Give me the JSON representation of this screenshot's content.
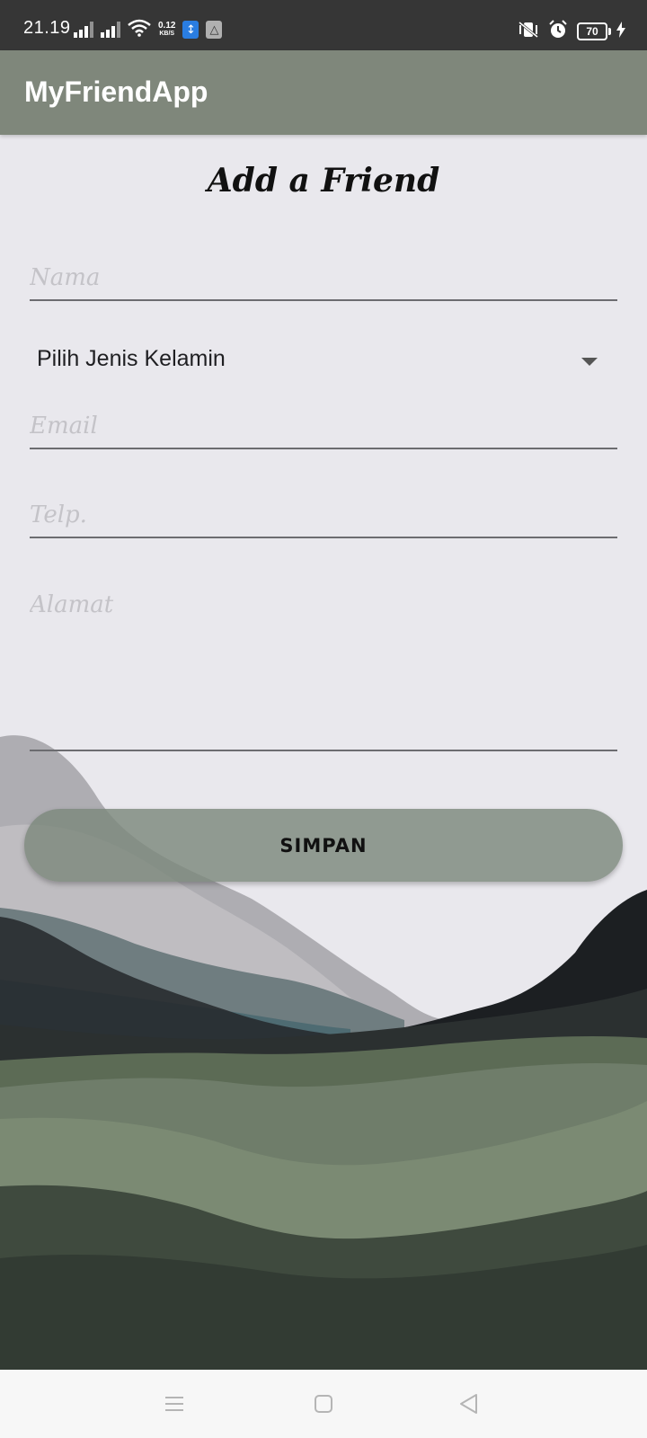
{
  "status_bar": {
    "time": "21.19",
    "net_speed_value": "0.12",
    "net_speed_unit": "KB/S",
    "battery_level": "70"
  },
  "app_bar": {
    "title": "MyFriendApp"
  },
  "form": {
    "heading": "Add a Friend",
    "name_placeholder": "Nama",
    "gender_spinner_label": "Pilih Jenis Kelamin",
    "email_placeholder": "Email",
    "phone_placeholder": "Telp.",
    "address_placeholder": "Alamat",
    "save_label": "SIMPAN"
  },
  "colors": {
    "status_bar": "#363636",
    "app_bar": "#7f877b",
    "background": "#e9e8ed",
    "button": "#8a9589"
  },
  "icons": {
    "signal_1": "cell-signal-icon",
    "signal_2": "cell-signal-icon",
    "wifi": "wifi-icon",
    "usb": "usb-icon",
    "notification": "app-notification-icon",
    "vibrate": "vibrate-icon",
    "alarm": "alarm-icon",
    "charging": "charging-icon",
    "nav_menu": "menu-icon",
    "nav_home": "home-icon",
    "nav_back": "back-icon"
  }
}
